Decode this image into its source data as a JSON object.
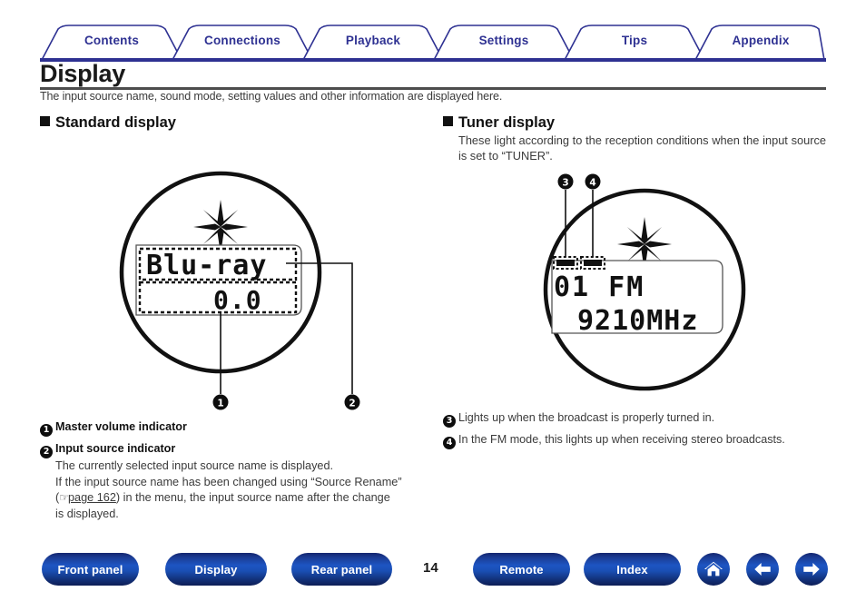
{
  "header": {
    "tabs": [
      {
        "label": "Contents"
      },
      {
        "label": "Connections"
      },
      {
        "label": "Playback"
      },
      {
        "label": "Settings"
      },
      {
        "label": "Tips"
      },
      {
        "label": "Appendix"
      }
    ],
    "accent_color": "#2e3192"
  },
  "title": "Display",
  "intro": "The input source name, sound mode, setting values and other information are displayed here.",
  "left_section": {
    "heading": "Standard display",
    "lcd": {
      "line1": "Blu-ray",
      "line2": "0.0"
    },
    "callouts": [
      {
        "marker": "1"
      },
      {
        "marker": "2"
      }
    ],
    "captions": [
      {
        "marker": "1",
        "title": "Master volume indicator",
        "body": []
      },
      {
        "marker": "2",
        "title": "Input source indicator",
        "body": [
          "The currently selected input source name is displayed.",
          "If the input source name has been changed using “Source Rename”",
          "(☞ page 162) in the menu, the input source name after the change",
          "is displayed."
        ],
        "link_text": "page 162",
        "link_prefix": "(",
        "link_icon": "pointing-hand-icon"
      }
    ]
  },
  "right_section": {
    "heading": "Tuner display",
    "subtext": "These light according to the reception conditions when the input source is set to “TUNER”.",
    "lcd": {
      "line1": "01 FM",
      "line2": "9210MHz"
    },
    "callouts": [
      {
        "marker": "3"
      },
      {
        "marker": "4"
      }
    ],
    "captions": [
      {
        "marker": "3",
        "text": "Lights up when the broadcast is properly turned in."
      },
      {
        "marker": "4",
        "text": "In the FM mode, this lights up when receiving stereo broadcasts."
      }
    ]
  },
  "footer": {
    "buttons": [
      {
        "label": "Front panel"
      },
      {
        "label": "Display"
      },
      {
        "label": "Rear panel"
      },
      {
        "label": "Remote"
      },
      {
        "label": "Index"
      }
    ],
    "icons": [
      {
        "name": "home-icon"
      },
      {
        "name": "arrow-left-icon"
      },
      {
        "name": "arrow-right-icon"
      }
    ],
    "page_number": "14",
    "button_color": "#1d55c2"
  }
}
